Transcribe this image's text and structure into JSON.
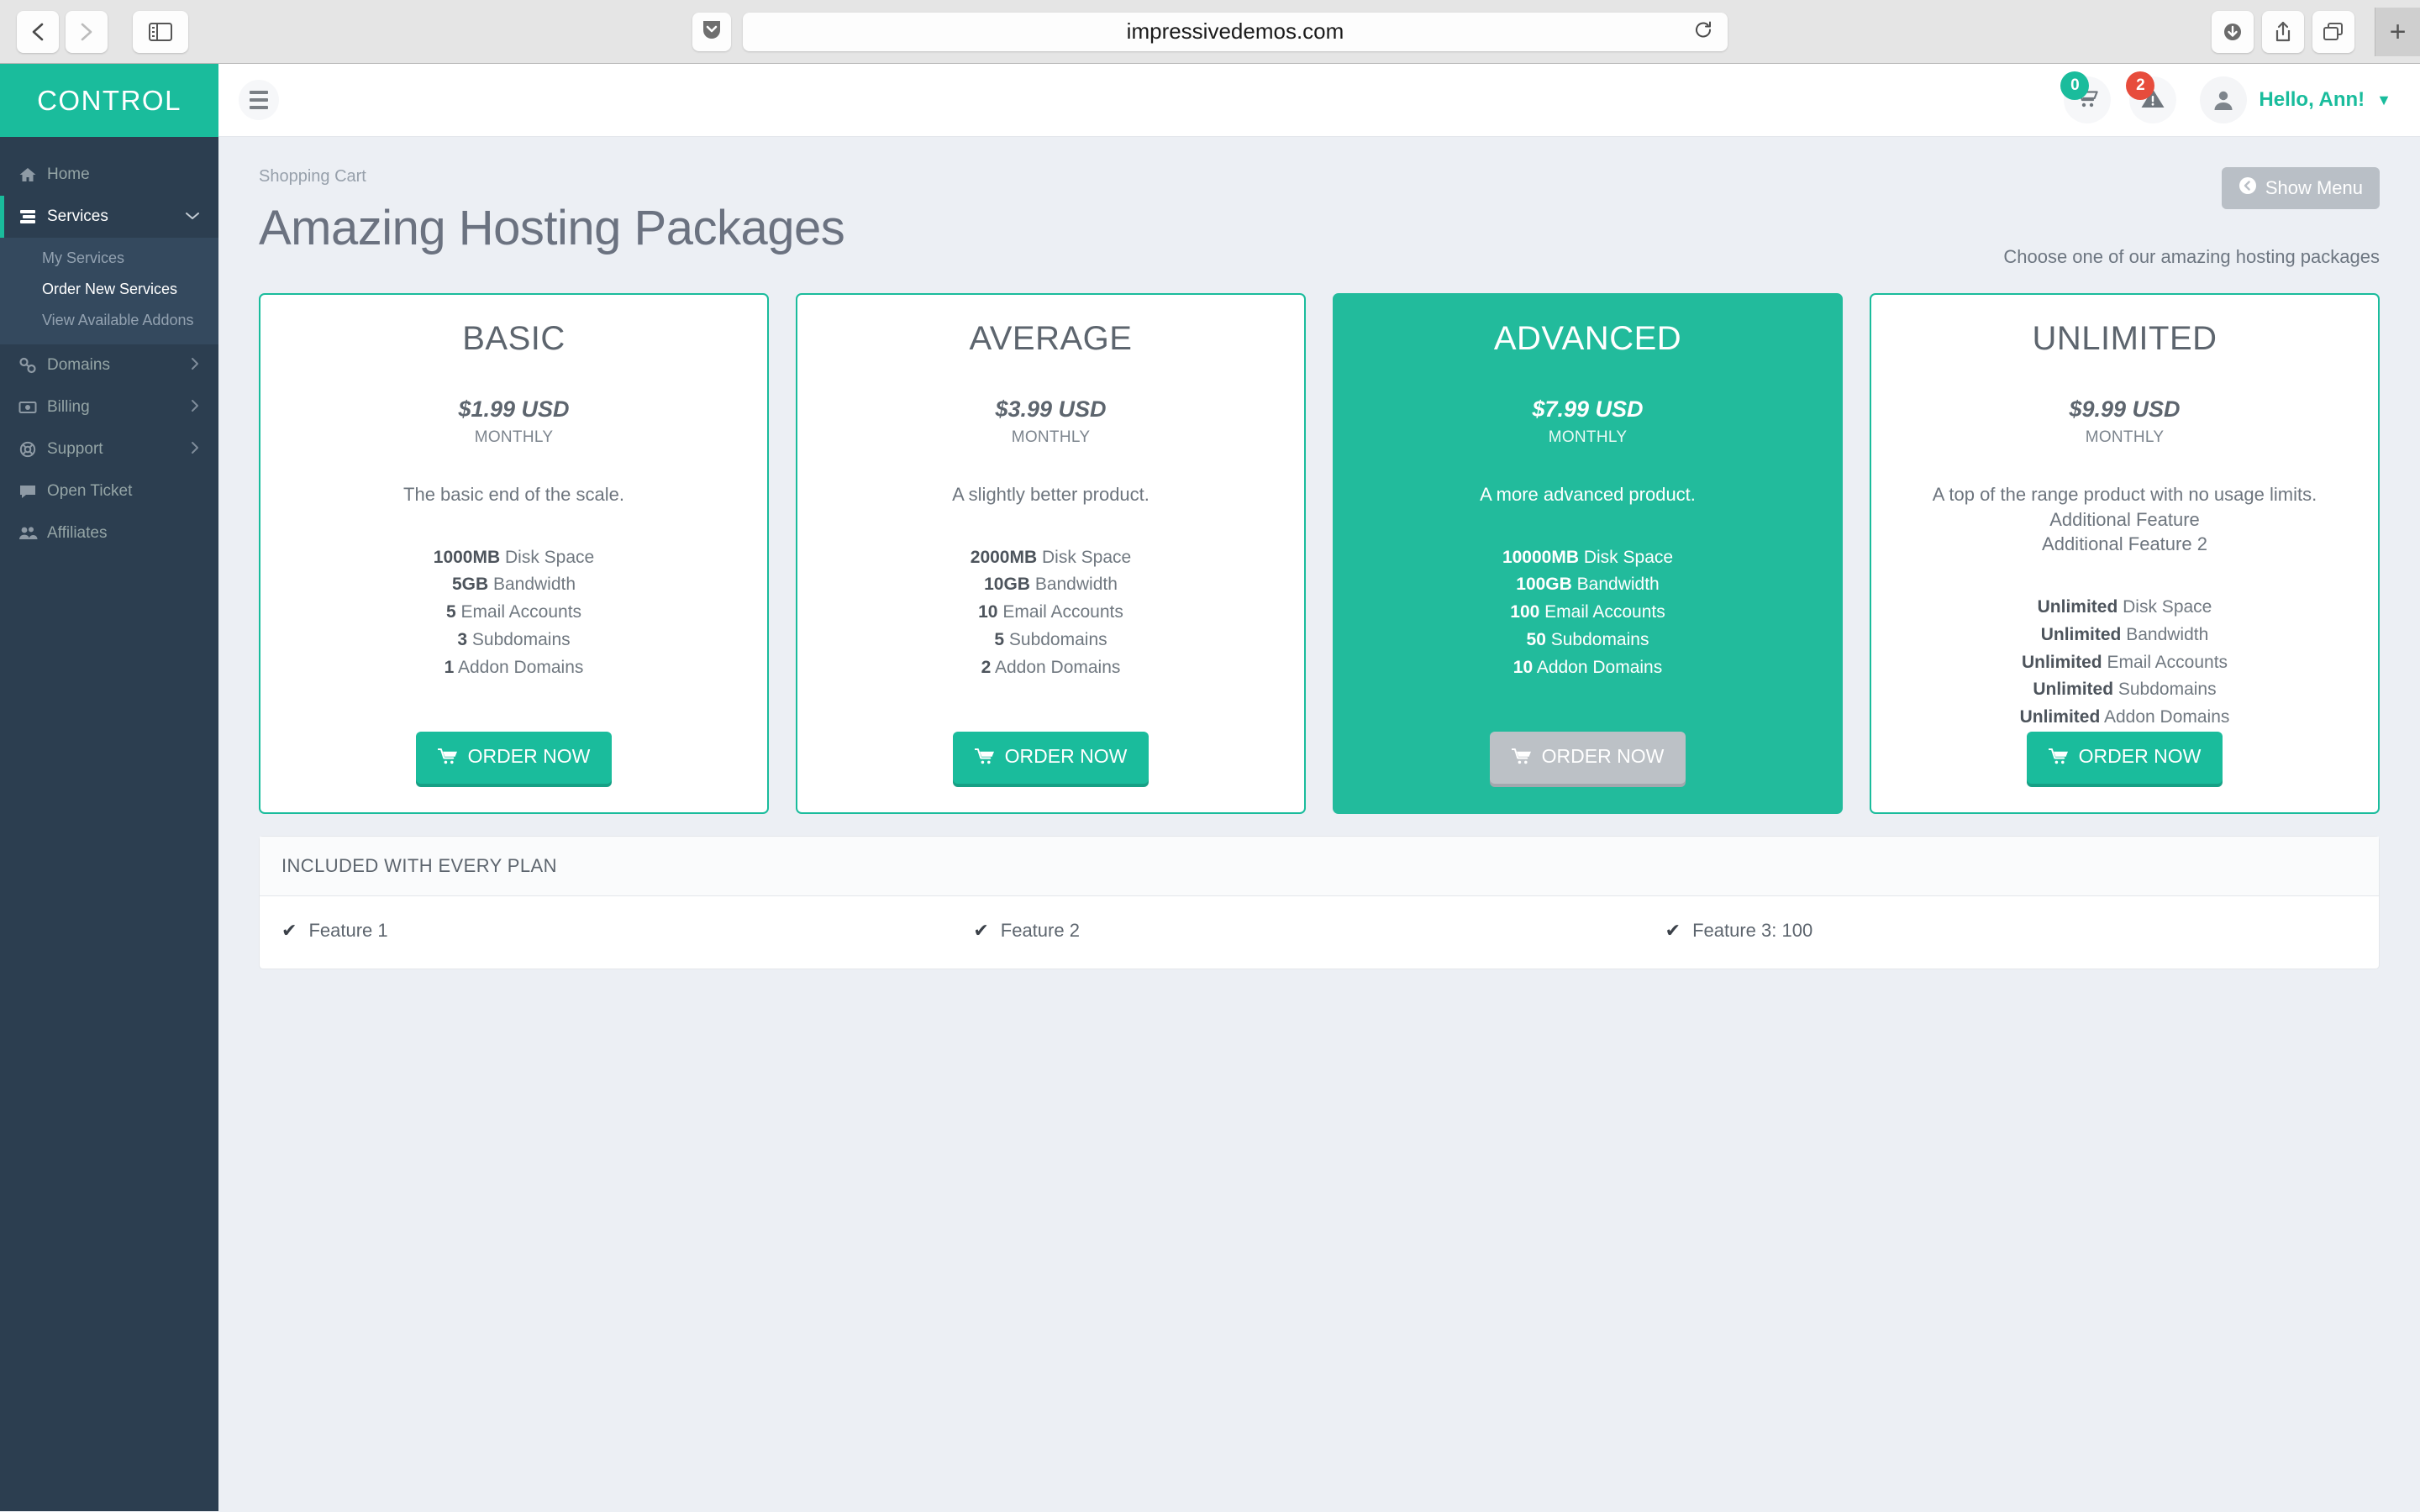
{
  "browser": {
    "url": "impressivedemos.com",
    "back_icon": "chevron-left-icon",
    "forward_icon": "chevron-right-icon",
    "sidebar_icon": "sidebar-toggle-icon",
    "pocket_icon": "pocket-icon",
    "reload_icon": "reload-icon",
    "download_icon": "download-icon",
    "share_icon": "share-icon",
    "tabs_icon": "tab-overview-icon",
    "newtab_label": "+"
  },
  "sidebar": {
    "brand": "CONTROL",
    "items": [
      {
        "label": "Home",
        "icon": "home-icon",
        "active": false,
        "caret": ""
      },
      {
        "label": "Services",
        "icon": "server-icon",
        "active": true,
        "caret": "⌄"
      },
      {
        "label": "Domains",
        "icon": "link-icon",
        "active": false,
        "caret": "›"
      },
      {
        "label": "Billing",
        "icon": "money-bill-icon",
        "active": false,
        "caret": "›"
      },
      {
        "label": "Support",
        "icon": "life-ring-icon",
        "active": false,
        "caret": "›"
      },
      {
        "label": "Open Ticket",
        "icon": "comment-icon",
        "active": false,
        "caret": ""
      },
      {
        "label": "Affiliates",
        "icon": "users-icon",
        "active": false,
        "caret": ""
      }
    ],
    "submenu": [
      {
        "label": "My Services",
        "active": false
      },
      {
        "label": "Order New Services",
        "active": true
      },
      {
        "label": "View Available Addons",
        "active": false
      }
    ]
  },
  "topbar": {
    "menu_icon": "hamburger-icon",
    "cart_icon": "shopping-cart-icon",
    "cart_badge": "0",
    "alert_icon": "warning-triangle-icon",
    "alert_badge": "2",
    "avatar_icon": "user-icon",
    "greeting": "Hello, Ann!",
    "caret": "▼"
  },
  "page": {
    "breadcrumb": "Shopping Cart",
    "title": "Amazing Hosting Packages",
    "show_menu_label": "Show Menu",
    "show_menu_icon": "arrow-circle-left-icon",
    "subtitle": "Choose one of our amazing hosting packages"
  },
  "packages": [
    {
      "name": "BASIC",
      "price": "$1.99 USD",
      "cycle": "MONTHLY",
      "description": "The basic end of the scale.",
      "features": [
        {
          "value": "1000MB",
          "label": "Disk Space"
        },
        {
          "value": "5GB",
          "label": "Bandwidth"
        },
        {
          "value": "5",
          "label": "Email Accounts"
        },
        {
          "value": "3",
          "label": "Subdomains"
        },
        {
          "value": "1",
          "label": "Addon Domains"
        }
      ],
      "button": "ORDER NOW",
      "featured": false
    },
    {
      "name": "AVERAGE",
      "price": "$3.99 USD",
      "cycle": "MONTHLY",
      "description": "A slightly better product.",
      "features": [
        {
          "value": "2000MB",
          "label": "Disk Space"
        },
        {
          "value": "10GB",
          "label": "Bandwidth"
        },
        {
          "value": "10",
          "label": "Email Accounts"
        },
        {
          "value": "5",
          "label": "Subdomains"
        },
        {
          "value": "2",
          "label": "Addon Domains"
        }
      ],
      "button": "ORDER NOW",
      "featured": false
    },
    {
      "name": "ADVANCED",
      "price": "$7.99 USD",
      "cycle": "MONTHLY",
      "description": "A more advanced product.",
      "features": [
        {
          "value": "10000MB",
          "label": "Disk Space"
        },
        {
          "value": "100GB",
          "label": "Bandwidth"
        },
        {
          "value": "100",
          "label": "Email Accounts"
        },
        {
          "value": "50",
          "label": "Subdomains"
        },
        {
          "value": "10",
          "label": "Addon Domains"
        }
      ],
      "button": "ORDER NOW",
      "featured": true
    },
    {
      "name": "UNLIMITED",
      "price": "$9.99 USD",
      "cycle": "MONTHLY",
      "description": "A top of the range product with no usage limits.\nAdditional Feature\nAdditional Feature 2",
      "features": [
        {
          "value": "Unlimited",
          "label": "Disk Space"
        },
        {
          "value": "Unlimited",
          "label": "Bandwidth"
        },
        {
          "value": "Unlimited",
          "label": "Email Accounts"
        },
        {
          "value": "Unlimited",
          "label": "Subdomains"
        },
        {
          "value": "Unlimited",
          "label": "Addon Domains"
        }
      ],
      "button": "ORDER NOW",
      "featured": false
    }
  ],
  "included": {
    "heading": "INCLUDED WITH EVERY PLAN",
    "items": [
      "Feature 1",
      "Feature 2",
      "Feature 3: 100"
    ],
    "check_icon": "check-icon"
  },
  "colors": {
    "accent": "#1abc9c",
    "sidebar": "#2c3e50",
    "submenu": "#34495e",
    "alert": "#e74c3c",
    "page_bg": "#eceff4"
  }
}
